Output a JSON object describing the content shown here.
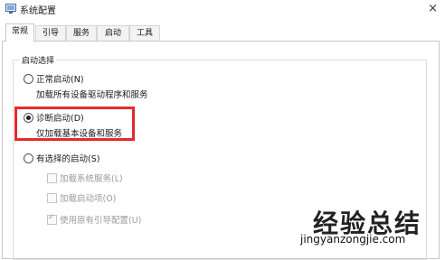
{
  "window": {
    "title": "系统配置",
    "close_glyph": "×",
    "app_icon": "msconfig-icon"
  },
  "tabs": [
    {
      "label": "常规",
      "active": true
    },
    {
      "label": "引导",
      "active": false
    },
    {
      "label": "服务",
      "active": false
    },
    {
      "label": "启动",
      "active": false
    },
    {
      "label": "工具",
      "active": false
    }
  ],
  "startup_selection": {
    "group_label": "启动选择",
    "options": [
      {
        "label": "正常启动(N)",
        "desc": "加载所有设备驱动程序和服务",
        "selected": false
      },
      {
        "label": "诊断启动(D)",
        "desc": "仅加载基本设备和服务",
        "selected": true
      },
      {
        "label": "有选择的启动(S)",
        "selected": false
      }
    ],
    "selective_items": [
      {
        "label": "加载系统服务(L)",
        "checked": false,
        "enabled": false
      },
      {
        "label": "加载启动项(O)",
        "checked": false,
        "enabled": false
      },
      {
        "label": "使用原有引导配置(U)",
        "checked": true,
        "enabled": false
      }
    ]
  },
  "highlight_color": "#e32b2b",
  "watermark": {
    "text": "经验总结",
    "url": "jingyanzongjie.com"
  }
}
